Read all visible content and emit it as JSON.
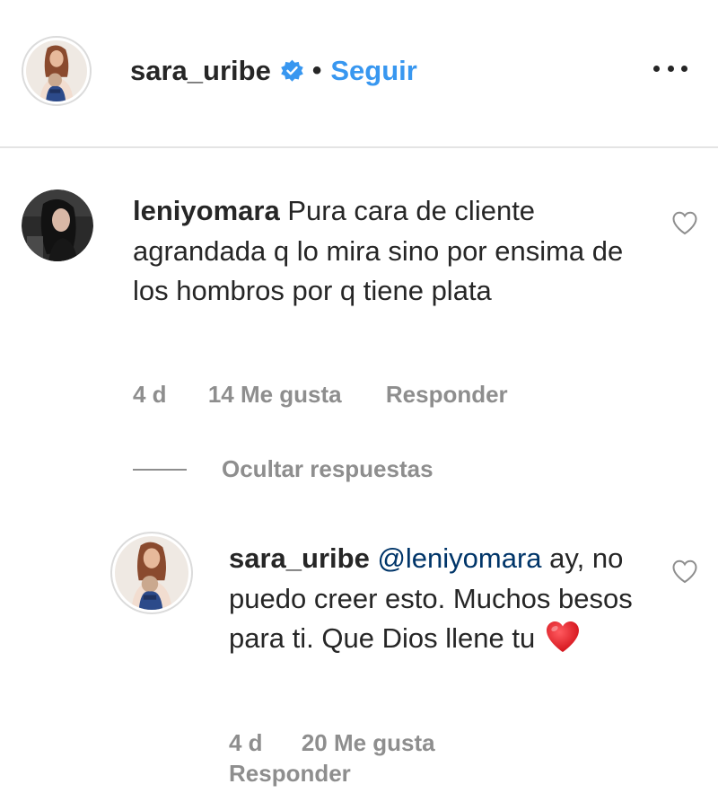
{
  "post_header": {
    "username": "sara_uribe",
    "separator": "•",
    "follow_label": "Seguir"
  },
  "comments": [
    {
      "username": "leniyomara",
      "text": "Pura cara de cliente agrandada q lo mira sino por ensima de los hombros por q tiene plata",
      "time": "4 d",
      "likes": "14 Me gusta",
      "reply_label": "Responder",
      "hide_replies_label": "Ocultar respuestas",
      "replies": [
        {
          "username": "sara_uribe",
          "mention": "@leniyomara",
          "text": " ay, no puedo creer esto. Muchos besos para ti. Que Dios llene tu ",
          "emoji": "red-heart",
          "time": "4 d",
          "likes": "20 Me gusta",
          "reply_label": "Responder"
        }
      ]
    }
  ],
  "colors": {
    "text": "#262626",
    "link": "#3897f0",
    "mention": "#003569",
    "muted": "#8e8e8e",
    "verified": "#3897f0",
    "heart": "#e0242a"
  }
}
